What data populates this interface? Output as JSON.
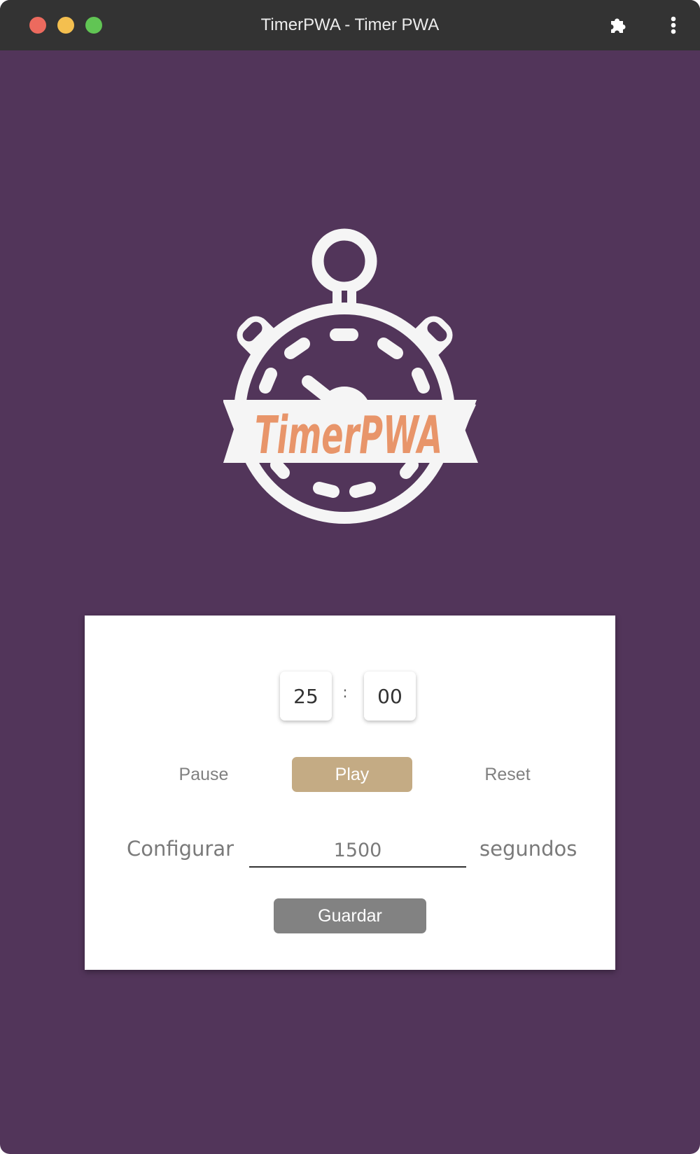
{
  "window": {
    "title": "TimerPWA - Timer PWA",
    "background_color": "#52355a",
    "titlebar_color": "#333333",
    "traffic_lights": {
      "close_color": "#ec6a5e",
      "minimize_color": "#f4bf4f",
      "maximize_color": "#61c554"
    },
    "toolbar_icons": [
      "puzzle-icon",
      "kebab-menu-icon"
    ]
  },
  "logo": {
    "icon": "stopwatch-icon",
    "text": "TimerPWA",
    "text_color": "#e8956a",
    "icon_color": "#f5f5f5"
  },
  "timer": {
    "minutes": "25",
    "separator": ":",
    "seconds": "00"
  },
  "controls": {
    "pause_label": "Pause",
    "play_label": "Play",
    "reset_label": "Reset",
    "play_color": "#c4ab84"
  },
  "config": {
    "label": "Configurar",
    "value": "1500",
    "unit": "segundos",
    "save_label": "Guardar",
    "save_color": "#828282"
  }
}
